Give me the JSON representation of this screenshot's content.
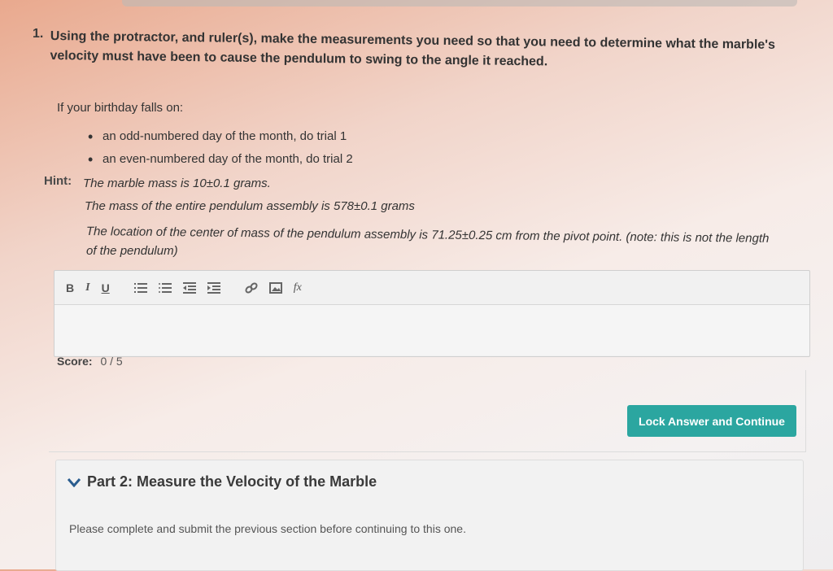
{
  "question": {
    "number": "1.",
    "text": "Using the protractor, and ruler(s), make the measurements you need so that you need to determine what the marble's velocity must have been to cause the pendulum to swing to the angle it reached."
  },
  "birthday": {
    "intro": "If your birthday falls on:",
    "options": [
      "an odd-numbered day of the month, do trial 1",
      "an even-numbered day of the month, do trial 2"
    ]
  },
  "hint": {
    "label": "Hint:",
    "lines": [
      "The marble mass is 10±0.1 grams.",
      "The mass of the entire pendulum assembly is 578±0.1 grams",
      "The location of the center of mass of the pendulum assembly is 71.25±0.25 cm from the pivot point. (note: this is not the length",
      "of the pendulum)"
    ]
  },
  "editor": {
    "bold": "B",
    "italic": "I",
    "underline": "U",
    "formula": "fx"
  },
  "score": {
    "label": "Score:",
    "value": "0 / 5"
  },
  "lock_button": "Lock Answer and Continue",
  "part2": {
    "title": "Part 2: Measure the Velocity of the Marble",
    "message": "Please complete and submit the previous section before continuing to this one."
  },
  "colors": {
    "accent": "#2ba6a0"
  }
}
